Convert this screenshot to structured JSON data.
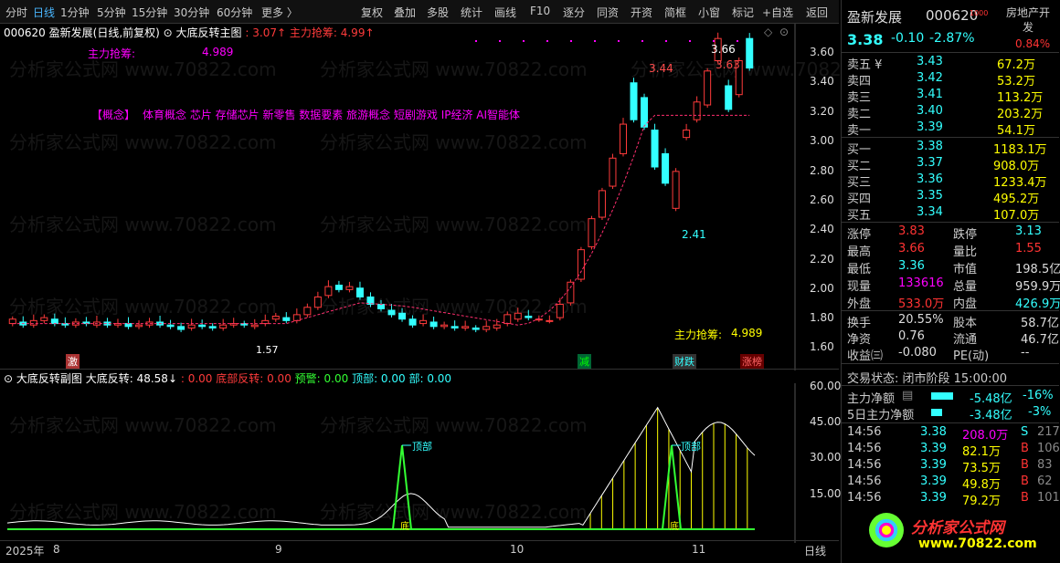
{
  "toolbar": {
    "left": [
      "分时",
      "日线",
      "1分钟",
      "5分钟",
      "15分钟",
      "30分钟",
      "60分钟",
      "更多 〉"
    ],
    "right": [
      "复权",
      "叠加",
      "多股",
      "统计",
      "画线",
      "F10",
      "逐分",
      "同资",
      "开资",
      "简框",
      "小窗",
      "标记",
      "+自选",
      "返回"
    ]
  },
  "main": {
    "code": "000620",
    "name_line": "盈新发展(日线,前复权)",
    "indicator": "大底反转主图",
    "ind_val1": ": 3.07↑",
    "ind_label2": "主力抢筹:",
    "ind_val2": "4.99↑",
    "zhuli_label": "主力抢筹:",
    "zhuli_val": "4.989",
    "concept_label": "【概念】",
    "concepts": "体育概念 芯片 存储芯片 新零售 数据要素 旅游概念 短剧游戏 IP经济 AI智能体",
    "hi_label": "3.44",
    "lo_label": "2.41",
    "hi2_label": "3.66",
    "hi3_label": "3.63",
    "low_mark": "1.57",
    "zhuli2_label": "主力抢筹:",
    "zhuli2_val": "4.989",
    "ticks": [
      "3.60",
      "3.40",
      "3.20",
      "3.00",
      "2.80",
      "2.60",
      "2.40",
      "2.20",
      "2.00",
      "1.80",
      "1.60"
    ],
    "tags": [
      "激",
      "减",
      "财跌",
      "涨榜"
    ]
  },
  "sub": {
    "title": "大底反转副图",
    "l1": "大底反转: 48.58↓",
    "l2": ": 0.00",
    "l3": "底部反转: 0.00",
    "l4": "预警: 0.00",
    "l5": "顶部: 0.00",
    "l6": "部: 0.00",
    "ticks": [
      "60.00",
      "45.00",
      "30.00",
      "15.00"
    ],
    "top_label": "顶部",
    "bottom_label": "底"
  },
  "xaxis": {
    "labels": [
      "2025年",
      "8",
      "9",
      "10",
      "11"
    ],
    "period": "日线"
  },
  "watermark": "分析家公式网 www.70822.com",
  "rp": {
    "name": "盈新发展",
    "code": "000620",
    "flag": "1000",
    "sector": "房地产开发",
    "sector_pct": "0.84%",
    "price": "3.38",
    "chg": "-0.10",
    "pct": "-2.87%",
    "sells": [
      [
        "卖五 ¥",
        "3.43",
        "67.2万"
      ],
      [
        "卖四",
        "3.42",
        "53.2万"
      ],
      [
        "卖三",
        "3.41",
        "113.2万"
      ],
      [
        "卖二",
        "3.40",
        "203.2万"
      ],
      [
        "卖一",
        "3.39",
        "54.1万"
      ]
    ],
    "buys": [
      [
        "买一",
        "3.38",
        "1183.1万"
      ],
      [
        "买二",
        "3.37",
        "908.0万"
      ],
      [
        "买三",
        "3.36",
        "1233.4万"
      ],
      [
        "买四",
        "3.35",
        "495.2万"
      ],
      [
        "买五",
        "3.34",
        "107.0万"
      ]
    ],
    "stats": [
      [
        "涨停",
        "3.83",
        "跌停",
        "3.13"
      ],
      [
        "最高",
        "3.66",
        "量比",
        "1.55"
      ],
      [
        "最低",
        "3.36",
        "市值",
        "198.5亿"
      ],
      [
        "现量",
        "133616",
        "总量",
        "959.9万"
      ],
      [
        "外盘",
        "533.0万",
        "内盘",
        "426.9万"
      ]
    ],
    "stats2": [
      [
        "换手",
        "20.55%",
        "股本",
        "58.7亿"
      ],
      [
        "净资",
        "0.76",
        "流通",
        "46.7亿"
      ],
      [
        "收益㈢",
        "-0.080",
        "PE(动)",
        "--"
      ]
    ],
    "state": "交易状态: 闭市阶段 15:00:00",
    "flow": [
      [
        "主力净额",
        "-5.48亿",
        "-16%"
      ],
      [
        "5日主力净额",
        "-3.48亿",
        "-3%"
      ]
    ],
    "ticks": [
      [
        "14:56",
        "3.38",
        "208.0万",
        "S",
        "217"
      ],
      [
        "14:56",
        "3.39",
        "82.1万",
        "B",
        "106"
      ],
      [
        "14:56",
        "3.39",
        "73.5万",
        "B",
        "83"
      ],
      [
        "14:56",
        "3.39",
        "49.8万",
        "B",
        "62"
      ],
      [
        "14:56",
        "3.39",
        "79.2万",
        "B",
        "101"
      ]
    ],
    "logo": "分析家公式网",
    "logo_url": "www.70822.com"
  },
  "colors": {
    "up": "#ff3b3b",
    "down": "#3ff",
    "bg": "#000"
  }
}
